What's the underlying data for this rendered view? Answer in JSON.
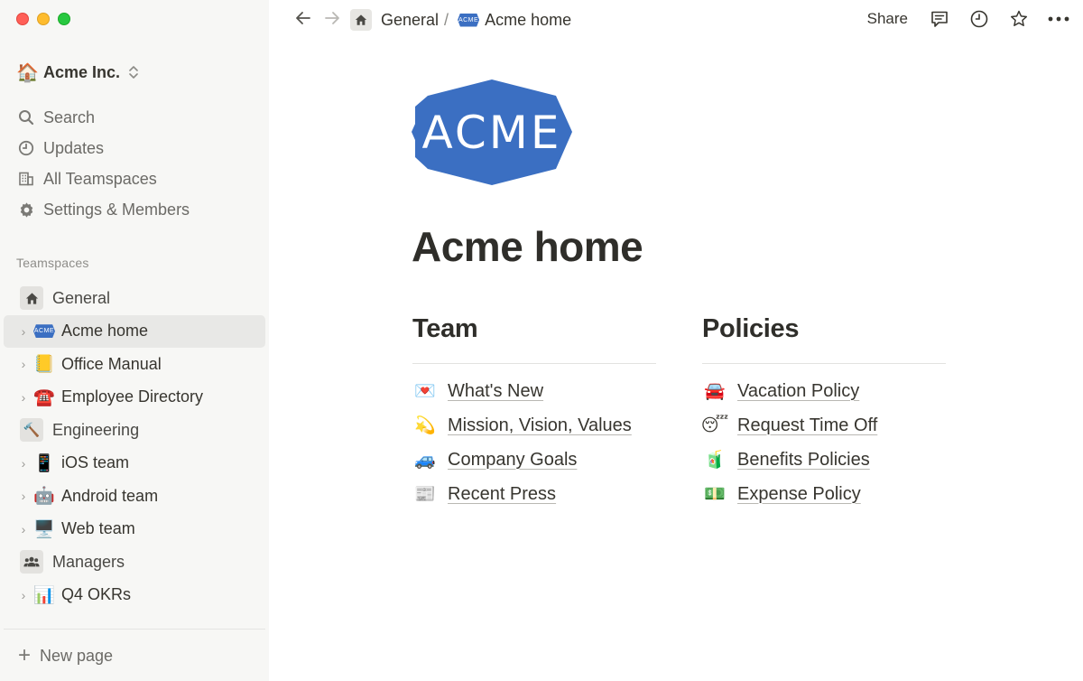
{
  "sidebar": {
    "workspace": {
      "emoji": "🏠",
      "name": "Acme Inc."
    },
    "nav": [
      {
        "icon": "search-icon",
        "label": "Search"
      },
      {
        "icon": "clock-icon",
        "label": "Updates"
      },
      {
        "icon": "building-icon",
        "label": "All Teamspaces"
      },
      {
        "icon": "gear-icon",
        "label": "Settings & Members"
      }
    ],
    "section_label": "Teamspaces",
    "tree": [
      {
        "kind": "space",
        "icon": "home-icon",
        "label": "General"
      },
      {
        "kind": "child",
        "icon": "acme-logo-icon",
        "label": "Acme home",
        "active": true
      },
      {
        "kind": "child",
        "emoji": "📒",
        "label": "Office Manual"
      },
      {
        "kind": "child",
        "emoji": "☎️",
        "label": "Employee Directory"
      },
      {
        "kind": "space",
        "emoji": "🔨",
        "label": "Engineering"
      },
      {
        "kind": "child",
        "emoji": "📱",
        "label": "iOS team"
      },
      {
        "kind": "child",
        "emoji": "🤖",
        "label": "Android team"
      },
      {
        "kind": "child",
        "emoji": "🖥️",
        "label": "Web team"
      },
      {
        "kind": "space",
        "icon": "people-icon",
        "label": "Managers"
      },
      {
        "kind": "child",
        "emoji": "📊",
        "label": "Q4 OKRs"
      }
    ],
    "new_page_label": "New page"
  },
  "topbar": {
    "breadcrumb": [
      {
        "icon": "home-icon",
        "label": "General"
      },
      {
        "icon": "acme-logo-icon",
        "label": "Acme home"
      }
    ],
    "breadcrumb_separator": "/",
    "share_label": "Share"
  },
  "page": {
    "logo_text": "ACME",
    "title": "Acme home",
    "columns": [
      {
        "heading": "Team",
        "links": [
          {
            "emoji": "💌",
            "label": "What's New"
          },
          {
            "emoji": "💫",
            "label": "Mission, Vision, Values"
          },
          {
            "emoji": "🚙",
            "label": "Company Goals"
          },
          {
            "emoji": "📰",
            "label": "Recent Press"
          }
        ]
      },
      {
        "heading": "Policies",
        "links": [
          {
            "emoji": "🚘",
            "label": "Vacation Policy"
          },
          {
            "emoji": "😴",
            "label": "Request Time Off"
          },
          {
            "emoji": "🧃",
            "label": "Benefits Policies"
          },
          {
            "emoji": "💵",
            "label": "Expense Policy"
          }
        ]
      }
    ]
  },
  "colors": {
    "sidebar_bg": "#f7f7f5",
    "active_row": "#e8e8e6",
    "acme_blue": "#3b6fc2",
    "text": "#37352f"
  }
}
